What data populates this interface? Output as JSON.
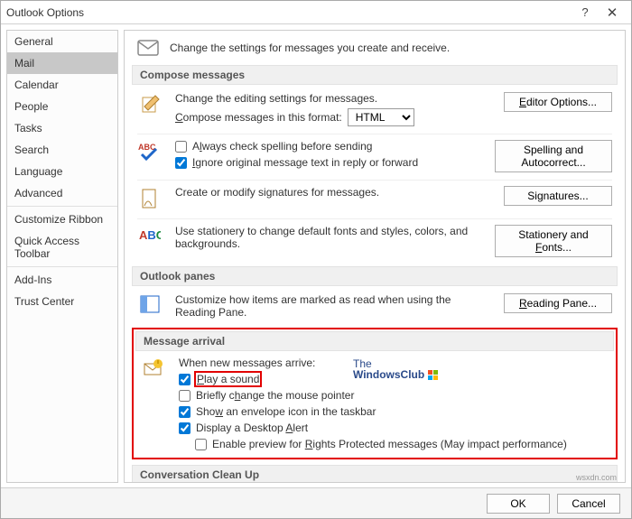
{
  "window": {
    "title": "Outlook Options",
    "help": "?",
    "close": "✕"
  },
  "sidebar": {
    "items": [
      {
        "label": "General"
      },
      {
        "label": "Mail",
        "selected": true
      },
      {
        "label": "Calendar"
      },
      {
        "label": "People"
      },
      {
        "label": "Tasks"
      },
      {
        "label": "Search"
      },
      {
        "label": "Language"
      },
      {
        "label": "Advanced"
      }
    ],
    "items2": [
      {
        "label": "Customize Ribbon"
      },
      {
        "label": "Quick Access Toolbar"
      }
    ],
    "items3": [
      {
        "label": "Add-Ins"
      },
      {
        "label": "Trust Center"
      }
    ]
  },
  "intro": "Change the settings for messages you create and receive.",
  "section_compose": {
    "title": "Compose messages",
    "editing_text": "Change the editing settings for messages.",
    "format_label_pre": "",
    "format_underline": "C",
    "format_label_post": "ompose messages in this format:",
    "format_value": "HTML",
    "editor_btn": "Editor Options...",
    "spell_pre": "A",
    "spell_underline": "l",
    "spell_post": "ways check spelling before sending",
    "ignore_pre": "",
    "ignore_underline": "I",
    "ignore_post": "gnore original message text in reply or forward",
    "spelling_btn": "Spelling and Autocorrect...",
    "sig_text": "Create or modify signatures for messages.",
    "sig_btn": "Signatures...",
    "stat_text": "Use stationery to change default fonts and styles, colors, and backgrounds.",
    "stat_btn_pre": "Stationery and ",
    "stat_btn_u": "F",
    "stat_btn_post": "onts..."
  },
  "section_panes": {
    "title": "Outlook panes",
    "text": "Customize how items are marked as read when using the Reading Pane.",
    "btn_pre": "",
    "btn_u": "R",
    "btn_post": "eading Pane..."
  },
  "section_arrival": {
    "title": "Message arrival",
    "heading": "When new messages arrive:",
    "play_pre": "",
    "play_u": "P",
    "play_post": "lay a sound",
    "brief_pre": "Briefly c",
    "brief_u": "h",
    "brief_post": "ange the mouse pointer",
    "env_pre": "Sho",
    "env_u": "w",
    "env_post": " an envelope icon in the taskbar",
    "desk_pre": "Display a Desktop ",
    "desk_u": "A",
    "desk_post": "lert",
    "enable_pre": "Enable preview for ",
    "enable_u": "R",
    "enable_post": "ights Protected messages (May impact performance)"
  },
  "section_cleanup": {
    "title": "Conversation Clean Up"
  },
  "footer": {
    "ok": "OK",
    "cancel": "Cancel"
  },
  "logo": {
    "line1": "The",
    "line2": "WindowsClub"
  },
  "watermark": "wsxdn.com"
}
